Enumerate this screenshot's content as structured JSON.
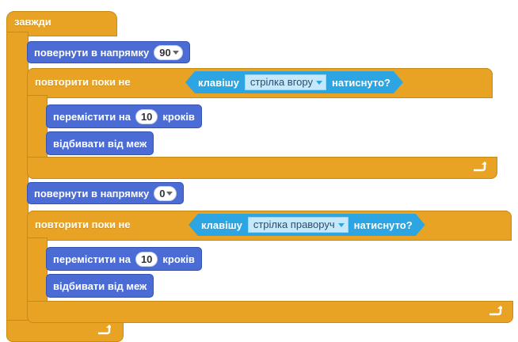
{
  "colors": {
    "control": "#e8a325",
    "motion": "#4a6cd4",
    "sensing": "#2ca5e2",
    "dropdown_bg": "#c5e9fb"
  },
  "script": {
    "forever_label": "завжди",
    "turn1": {
      "label": "повернути в напрямку",
      "value": "90"
    },
    "repeat1": {
      "label": "повторити поки не",
      "key_label": "клавішу",
      "key_value": "стрілка вгору",
      "pressed_label": "натиснуто?",
      "move": {
        "label_before": "перемістити на",
        "value": "10",
        "label_after": "кроків"
      },
      "bounce": {
        "label": "відбивати від меж"
      }
    },
    "turn2": {
      "label": "повернути в напрямку",
      "value": "0"
    },
    "repeat2": {
      "label": "повторити поки не",
      "key_label": "клавішу",
      "key_value": "стрілка праворуч",
      "pressed_label": "натиснуто?",
      "move": {
        "label_before": "перемістити на",
        "value": "10",
        "label_after": "кроків"
      },
      "bounce": {
        "label": "відбивати від меж"
      }
    }
  },
  "icons": {
    "loop_arrow": "loop-arrow-icon"
  }
}
